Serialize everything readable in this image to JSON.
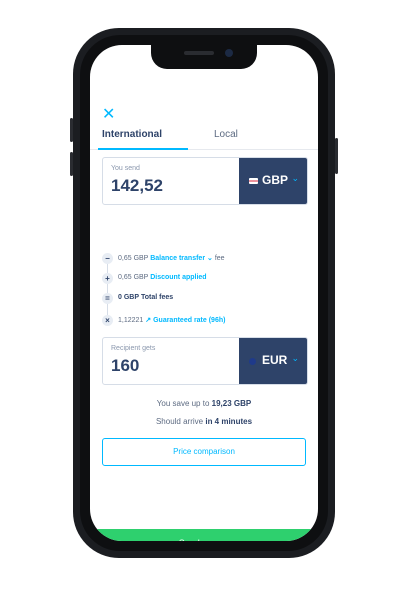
{
  "header": {
    "close_icon": "close-icon"
  },
  "tabs": [
    {
      "label": "International",
      "active": true
    },
    {
      "label": "Local",
      "active": false
    }
  ],
  "send_box": {
    "label": "You send",
    "amount": "142,52",
    "currency": "GBP"
  },
  "fees": [
    {
      "icon": "minus",
      "amount": "0,65 GBP",
      "link": "Balance transfer",
      "suffix": "fee"
    },
    {
      "icon": "plus",
      "amount": "0,65 GBP",
      "link": "Discount applied",
      "suffix": ""
    },
    {
      "icon": "equals",
      "amount": "0 GBP",
      "suffix": "Total fees"
    },
    {
      "icon": "times",
      "amount": "1,12221",
      "link": "Guaranteed rate (96h)",
      "suffix": ""
    }
  ],
  "receive_box": {
    "label": "Recipient gets",
    "amount": "160",
    "currency": "EUR"
  },
  "savings": {
    "prefix": "You save up to",
    "value": "19,23 GBP"
  },
  "arrival": {
    "prefix": "Should arrive",
    "value": "in 4 minutes"
  },
  "buttons": {
    "compare": "Price comparison",
    "send": "Send money"
  },
  "colors": {
    "accent": "#00b9ff",
    "navy": "#2e4369",
    "green": "#2ed06e"
  }
}
